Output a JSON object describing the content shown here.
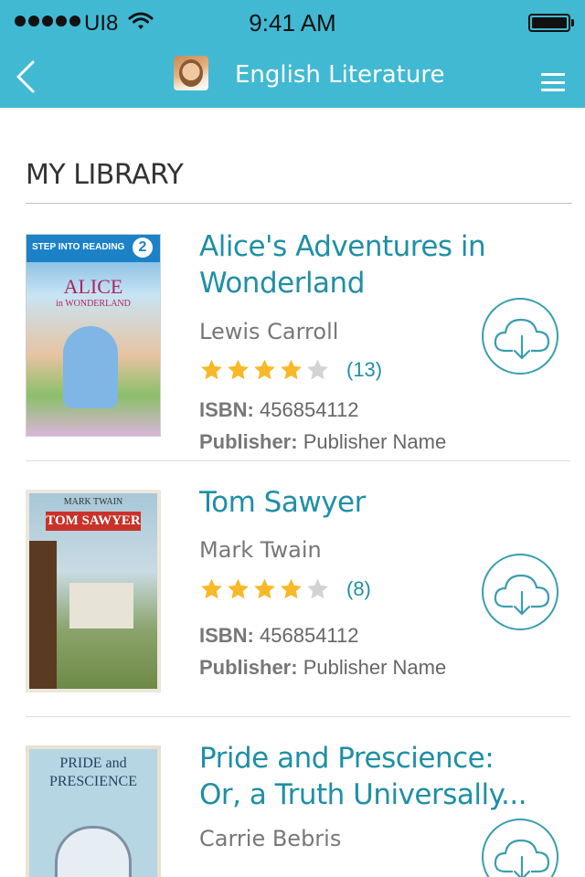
{
  "status": {
    "carrier": "UI8",
    "time": "9:41 AM"
  },
  "nav": {
    "title": "English Literature"
  },
  "library": {
    "heading": "MY LIBRARY"
  },
  "books": [
    {
      "title": "Alice's Adventures in Wonderland",
      "author": "Lewis Carroll",
      "rating": 4,
      "rating_count": "(13)",
      "isbn_label": "ISBN:",
      "isbn": "456854112",
      "publisher_label": "Publisher:",
      "publisher": "Publisher Name",
      "cover_text": "ALICE",
      "cover_sub": "in WONDERLAND",
      "cover_series": "STEP INTO READING",
      "cover_level": "2"
    },
    {
      "title": "Tom Sawyer",
      "author": "Mark Twain",
      "rating": 4,
      "rating_count": "(8)",
      "isbn_label": "ISBN:",
      "isbn": "456854112",
      "publisher_label": "Publisher:",
      "publisher": "Publisher Name",
      "cover_author": "MARK TWAIN",
      "cover_text": "TOM SAWYER"
    },
    {
      "title": "Pride and Prescience: Or, a  Truth Universally...",
      "author": "Carrie Bebris",
      "cover_text": "PRIDE and PRESCIENCE"
    }
  ],
  "colors": {
    "bar": "#41b9d3",
    "accent": "#1f8fa5",
    "star_on": "#f7b928",
    "star_off": "#d3d3d3"
  },
  "icons": {
    "back": "chevron-left-icon",
    "menu": "hamburger-icon",
    "download": "cloud-download-icon",
    "star": "star-icon",
    "wifi": "wifi-icon",
    "battery": "battery-icon"
  }
}
